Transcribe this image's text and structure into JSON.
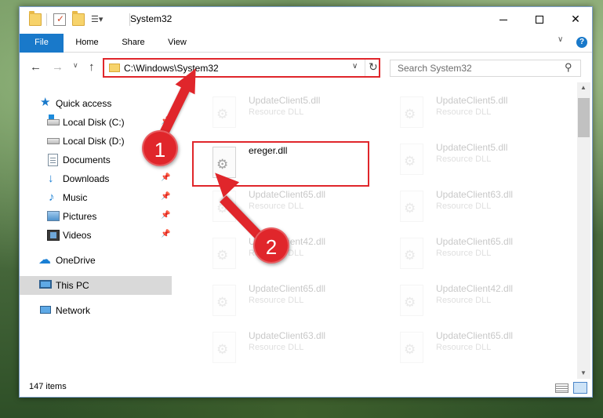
{
  "window": {
    "title": "System32"
  },
  "ribbon": {
    "file": "File",
    "home": "Home",
    "share": "Share",
    "view": "View",
    "help": "?"
  },
  "address": {
    "path": "C:\\Windows\\System32",
    "search_placeholder": "Search System32"
  },
  "nav": {
    "items": [
      {
        "label": "Quick access",
        "icon": "star-icon",
        "pinned": false
      },
      {
        "label": "Local Disk (C:)",
        "icon": "drive-icon",
        "pinned": true
      },
      {
        "label": "Local Disk (D:)",
        "icon": "drive-icon",
        "pinned": true
      },
      {
        "label": "Documents",
        "icon": "documents-icon",
        "pinned": true
      },
      {
        "label": "Downloads",
        "icon": "download-icon",
        "pinned": true
      },
      {
        "label": "Music",
        "icon": "music-icon",
        "pinned": true
      },
      {
        "label": "Pictures",
        "icon": "pictures-icon",
        "pinned": true
      },
      {
        "label": "Videos",
        "icon": "videos-icon",
        "pinned": true
      },
      {
        "label": "OneDrive",
        "icon": "cloud-icon",
        "pinned": false
      },
      {
        "label": "This PC",
        "icon": "computer-icon",
        "pinned": false,
        "selected": true
      },
      {
        "label": "Network",
        "icon": "network-icon",
        "pinned": false
      }
    ]
  },
  "files": [
    {
      "name": "UpdateClient5.dll",
      "type": "Resource DLL"
    },
    {
      "name": "UpdateClient5.dll",
      "type": "Resource DLL"
    },
    {
      "name": "ereger.dll",
      "type": ""
    },
    {
      "name": "UpdateClient5.dll",
      "type": "Resource DLL"
    },
    {
      "name": "UpdateClient65.dll",
      "type": "Resource DLL"
    },
    {
      "name": "UpdateClient63.dll",
      "type": "Resource DLL"
    },
    {
      "name": "UpdateClient42.dll",
      "type": "Resource DLL"
    },
    {
      "name": "UpdateClient65.dll",
      "type": "Resource DLL"
    },
    {
      "name": "UpdateClient65.dll",
      "type": "Resource DLL"
    },
    {
      "name": "UpdateClient42.dll",
      "type": "Resource DLL"
    },
    {
      "name": "UpdateClient63.dll",
      "type": "Resource DLL"
    },
    {
      "name": "UpdateClient65.dll",
      "type": "Resource DLL"
    }
  ],
  "status": {
    "items": "147 items"
  },
  "annotations": {
    "badge1": "1",
    "badge2": "2",
    "color": "#e0262b"
  }
}
